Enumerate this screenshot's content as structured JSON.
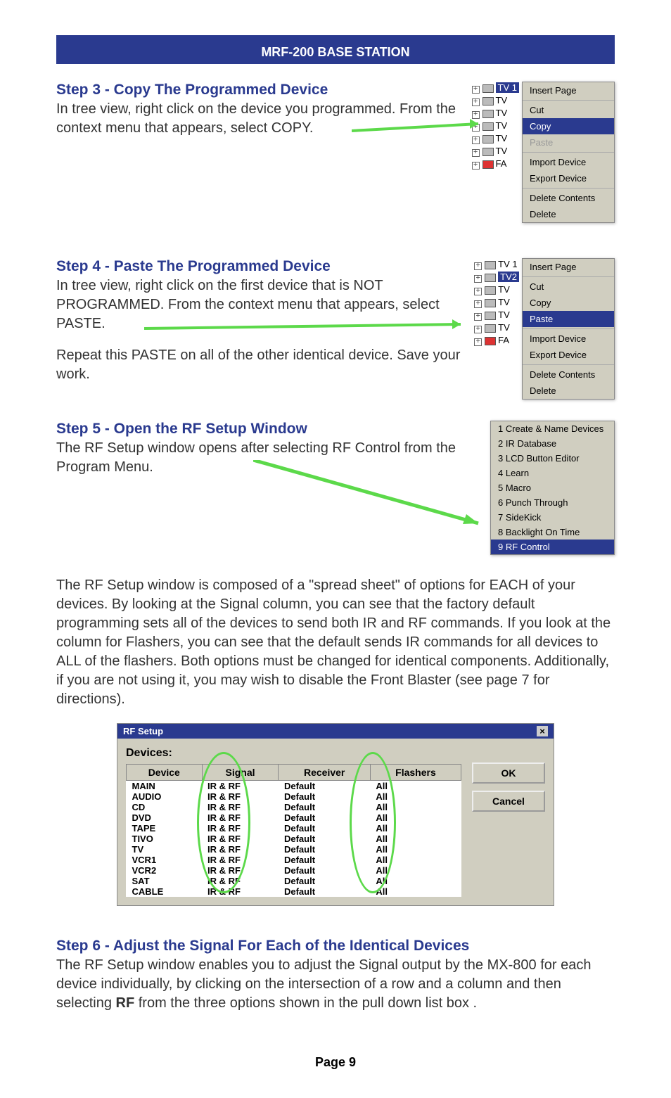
{
  "header": "MRF-200 BASE STATION",
  "step3": {
    "title": "Step 3 - Copy The Programmed Device",
    "text": "In tree view, right click on the device you programmed. From the context menu that appears, select COPY.",
    "tree": [
      "TV 1",
      "TV",
      "TV",
      "TV",
      "TV",
      "TV",
      "FA"
    ],
    "menu": {
      "insert_page": "Insert Page",
      "cut": "Cut",
      "copy": "Copy",
      "paste": "Paste",
      "import_device": "Import Device",
      "export_device": "Export Device",
      "delete_contents": "Delete Contents",
      "delete": "Delete"
    }
  },
  "step4": {
    "title": "Step 4 - Paste The Programmed Device",
    "text": "In tree view, right click on the first device that is NOT PROGRAMMED. From the context menu that appears, select PASTE.",
    "text2": "Repeat this PASTE on all of the other identical device. Save your work.",
    "tree": [
      "TV 1",
      "TV2",
      "TV",
      "TV",
      "TV",
      "TV",
      "FA"
    ],
    "menu": {
      "insert_page": "Insert Page",
      "cut": "Cut",
      "copy": "Copy",
      "paste": "Paste",
      "import_device": "Import Device",
      "export_device": "Export Device",
      "delete_contents": "Delete Contents",
      "delete": "Delete"
    }
  },
  "step5": {
    "title": "Step 5 - Open the RF Setup Window",
    "text": " The RF Setup window opens after selecting RF Control from the Program Menu.",
    "menu": [
      "1 Create & Name Devices",
      "2 IR Database",
      "3 LCD Button Editor",
      "4 Learn",
      "5 Macro",
      "6 Punch Through",
      "7 SideKick",
      "8 Backlight On Time",
      "9 RF Control"
    ]
  },
  "rf_paragraph": "The RF Setup window is composed of a \"spread sheet\" of options for EACH of your devices.  By looking at the Signal column, you can see that the factory default programming sets all of the devices to send both IR and RF commands. If you look at the column for Flashers, you can see that the default sends IR commands for all devices to ALL of the flashers. Both options must be changed for identical components. Additionally, if you are not using it, you may wish to disable the Front Blaster (see page 7 for directions).",
  "rf_setup": {
    "title": "RF Setup",
    "devices_label": "Devices:",
    "headers": [
      "Device",
      "Signal",
      "Receiver",
      "Flashers"
    ],
    "rows": [
      [
        "MAIN",
        "IR & RF",
        "Default",
        "All"
      ],
      [
        "AUDIO",
        "IR & RF",
        "Default",
        "All"
      ],
      [
        "CD",
        "IR & RF",
        "Default",
        "All"
      ],
      [
        "DVD",
        "IR & RF",
        "Default",
        "All"
      ],
      [
        "TAPE",
        "IR & RF",
        "Default",
        "All"
      ],
      [
        "TIVO",
        "IR & RF",
        "Default",
        "All"
      ],
      [
        "TV",
        "IR & RF",
        "Default",
        "All"
      ],
      [
        "VCR1",
        "IR & RF",
        "Default",
        "All"
      ],
      [
        "VCR2",
        "IR & RF",
        "Default",
        "All"
      ],
      [
        "SAT",
        "IR & RF",
        "Default",
        "All"
      ],
      [
        "CABLE",
        "IR & RF",
        "Default",
        "All"
      ]
    ],
    "ok": "OK",
    "cancel": "Cancel"
  },
  "step6": {
    "title": "Step 6 - Adjust the Signal For Each of the Identical Devices",
    "text_before": "The RF Setup window enables you to adjust the Signal output by the MX-800 for each device individually, by clicking on the intersection of a row and a column and then selecting ",
    "rf_word": "RF",
    "text_after": " from the three options shown in the pull down list box ."
  },
  "footer": "Page 9"
}
